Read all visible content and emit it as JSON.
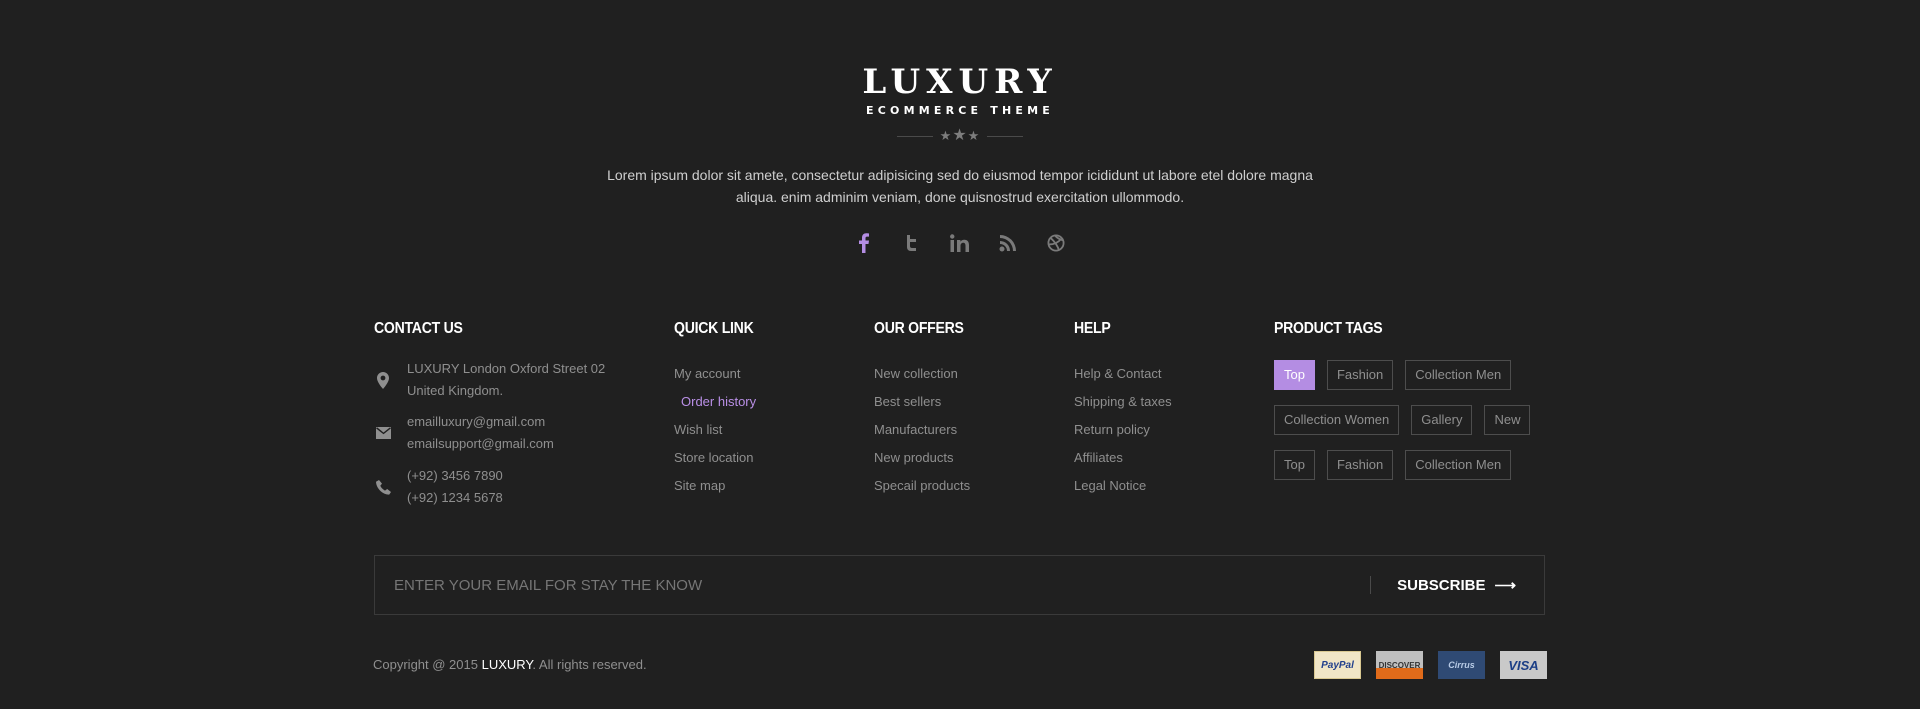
{
  "brand": {
    "title": "LUXURY",
    "subtitle": "ECOMMERCE THEME"
  },
  "about": "Lorem ipsum dolor sit amete, consectetur adipisicing sed do eiusmod tempor icididunt ut labore etel dolore magna aliqua. enim adminim veniam, done quisnostrud exercitation ullommodo.",
  "social": {
    "icons": [
      "facebook-icon",
      "twitter-icon",
      "linkedin-icon",
      "rss-icon",
      "dribbble-icon"
    ],
    "active_color": "#b48de3",
    "default_color": "#7a7a7a"
  },
  "contact": {
    "title": "CONTACT US",
    "address_line1": "LUXURY London Oxford Street 02",
    "address_line2": "United Kingdom.",
    "email1": "emailluxury@gmail.com",
    "email2": "emailsupport@gmail.com",
    "phone1": "(+92) 3456 7890",
    "phone2": "(+92) 1234 5678"
  },
  "quick_link": {
    "title": "QUICK LINK",
    "items": [
      "My account",
      "Order history",
      "Wish list",
      "Store location",
      "Site map"
    ],
    "active_index": 1
  },
  "offers": {
    "title": "OUR OFFERS",
    "items": [
      "New collection",
      "Best sellers",
      "Manufacturers",
      "New products",
      "Specail products"
    ]
  },
  "help": {
    "title": "HELP",
    "items": [
      "Help & Contact",
      "Shipping & taxes",
      "Return policy",
      "Affiliates",
      "Legal Notice"
    ]
  },
  "tags": {
    "title": "PRODUCT TAGS",
    "rows": [
      [
        "Top",
        "Fashion",
        "Collection Men"
      ],
      [
        "Collection Women",
        "Gallery",
        "New"
      ],
      [
        "Top",
        "Fashion",
        "Collection Men"
      ]
    ],
    "active": "Top"
  },
  "subscribe": {
    "placeholder": "ENTER YOUR EMAIL FOR STAY THE KNOW",
    "button_label": "SUBSCRIBE"
  },
  "copyright": {
    "prefix": "Copyright @ 2015 ",
    "brand": "LUXURY",
    "suffix": ". All rights reserved."
  },
  "payments": {
    "paypal": "PayPal",
    "discover": "DISCOVER",
    "cirrus": "Cirrus",
    "visa": "VISA"
  },
  "colors": {
    "background": "#202020",
    "accent": "#b48de3",
    "text_muted": "#8f8f8f",
    "heading": "#ffffff"
  }
}
